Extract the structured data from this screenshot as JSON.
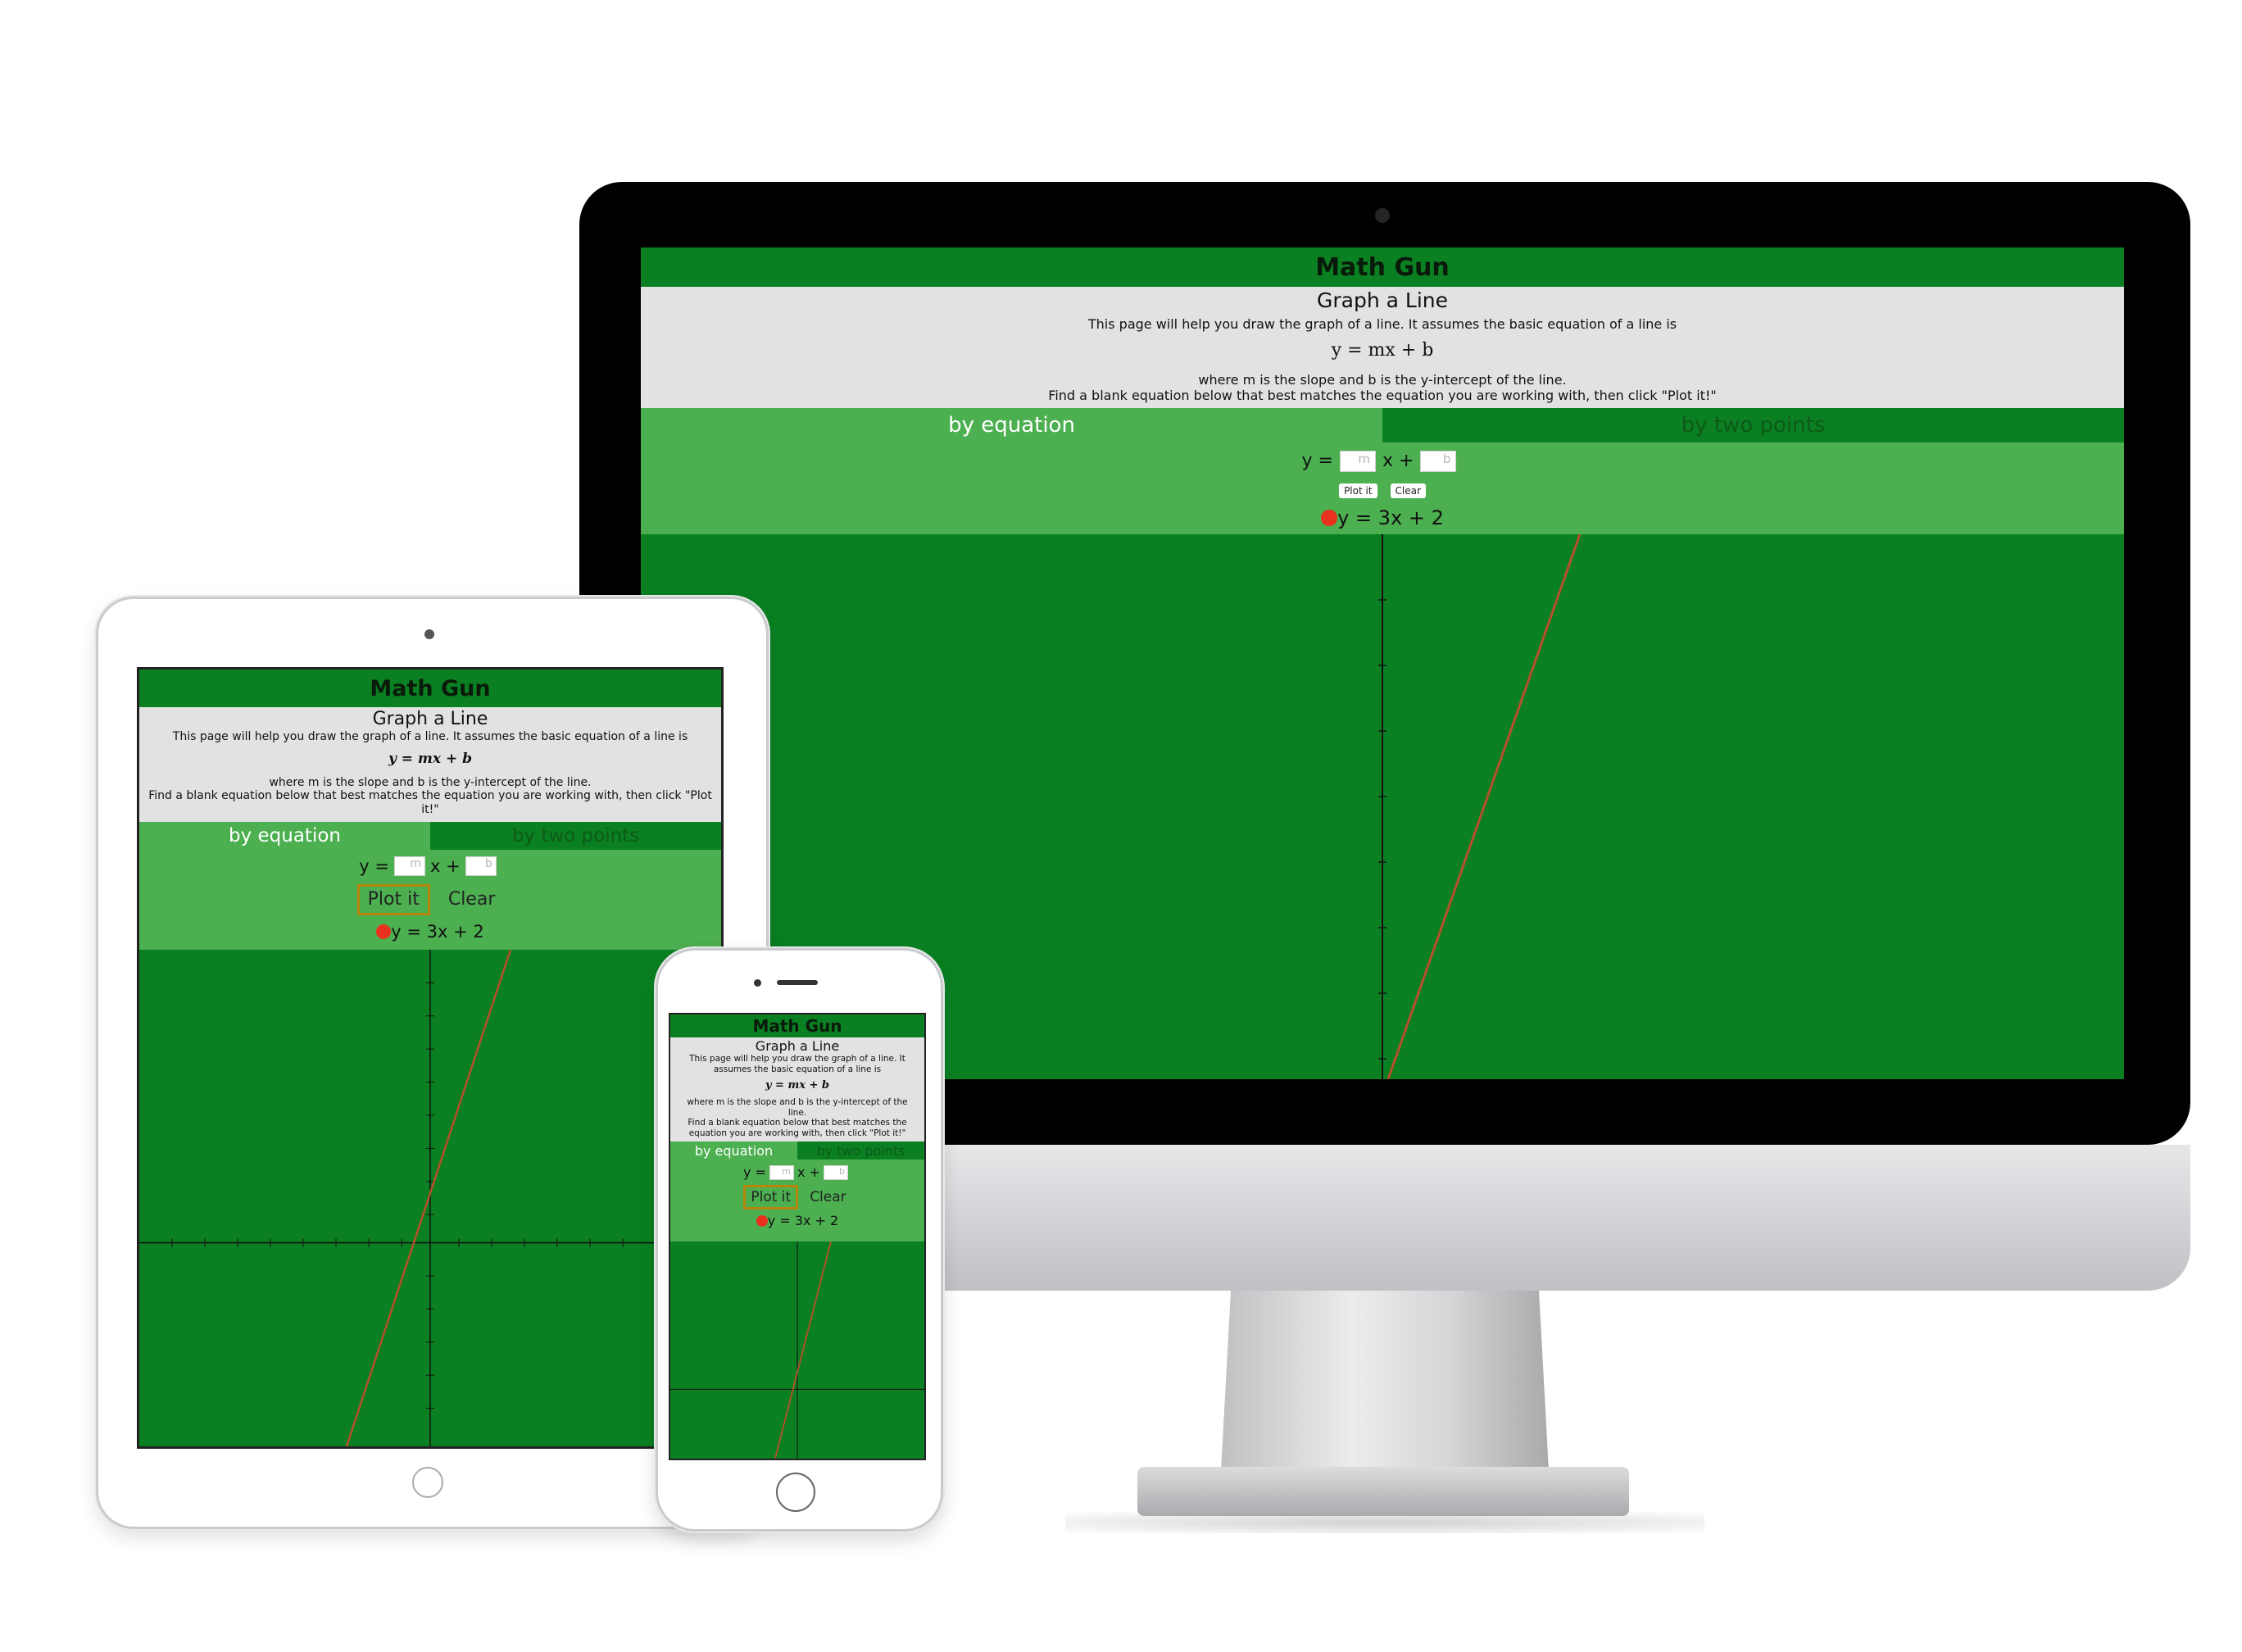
{
  "app": {
    "title": "Math Gun",
    "subtitle": "Graph a Line",
    "intro": "This page will help you draw the graph of a line. It assumes the basic equation of a line is",
    "equation": "y = mx + b",
    "explanation": "where m is the slope and b is the y-intercept of the line.",
    "instruction": "Find a blank equation below that best matches the equation you are working with, then click \"Plot it!\"",
    "tabs": [
      {
        "label": "by equation",
        "active": true
      },
      {
        "label": "by two points",
        "active": false
      }
    ],
    "form": {
      "y_label": "y =",
      "x_label": "x +",
      "m_placeholder": "m",
      "b_placeholder": "b",
      "plot_button": "Plot it",
      "clear_button": "Clear"
    },
    "plotted": {
      "label": "y = 3x + 2",
      "slope": 3,
      "intercept": 2,
      "marker_color": "#e8321e",
      "line_color": "#b5502a"
    },
    "colors": {
      "header_green": "#0a8022",
      "panel_green": "#4caf50",
      "info_gray": "#e2e2e2"
    }
  }
}
